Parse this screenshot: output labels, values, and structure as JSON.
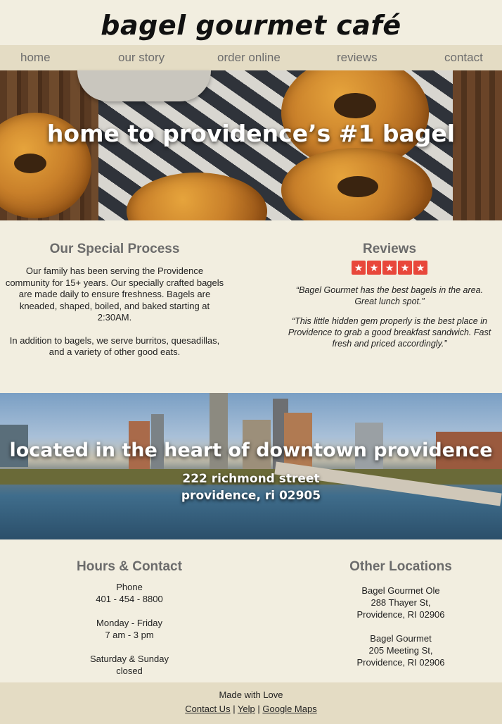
{
  "brand": {
    "logo": "bagel gourmet café"
  },
  "nav": {
    "items": [
      {
        "label": "home"
      },
      {
        "label": "our story"
      },
      {
        "label": "order online"
      },
      {
        "label": "reviews"
      },
      {
        "label": "contact"
      }
    ]
  },
  "hero": {
    "title": "home to providence’s #1 bagel"
  },
  "process": {
    "heading": "Our Special Process",
    "p1": "Our family has been serving the Providence community for 15+ years. Our specially crafted bagels are made daily to ensure freshness. Bagels are kneaded, shaped, boiled, and baked starting at 2:30AM.",
    "p2": "In addition to bagels, we serve burritos, quesadillas, and a variety of other good eats."
  },
  "reviews": {
    "heading": "Reviews",
    "rating": 5,
    "star_color": "#e8473b",
    "quotes": [
      "“Bagel Gourmet has the best bagels in the area. Great lunch spot.”",
      "“This little hidden gem properly is the best place in Providence to grab a good breakfast sandwich. Fast fresh and priced accordingly.”"
    ]
  },
  "location": {
    "title": "located in the heart of downtown providence",
    "street": "222 richmond street",
    "city": "providence, ri 02905"
  },
  "hours": {
    "heading": "Hours & Contact",
    "phone_label": "Phone",
    "phone": "401 - 454 - 8800",
    "weekday_label": "Monday - Friday",
    "weekday_hours": "7 am - 3 pm",
    "weekend_label": "Saturday & Sunday",
    "weekend_hours": "closed"
  },
  "locations": {
    "heading": "Other Locations",
    "items": [
      {
        "name": "Bagel Gourmet Ole",
        "street": "288 Thayer St,",
        "city": "Providence, RI 02906"
      },
      {
        "name": "Bagel Gourmet",
        "street": "205 Meeting St,",
        "city": "Providence, RI 02906"
      }
    ]
  },
  "footer": {
    "made": "Made with Love",
    "links": [
      {
        "label": "Contact Us"
      },
      {
        "label": "Yelp"
      },
      {
        "label": "Google Maps"
      }
    ],
    "separator": " | "
  }
}
